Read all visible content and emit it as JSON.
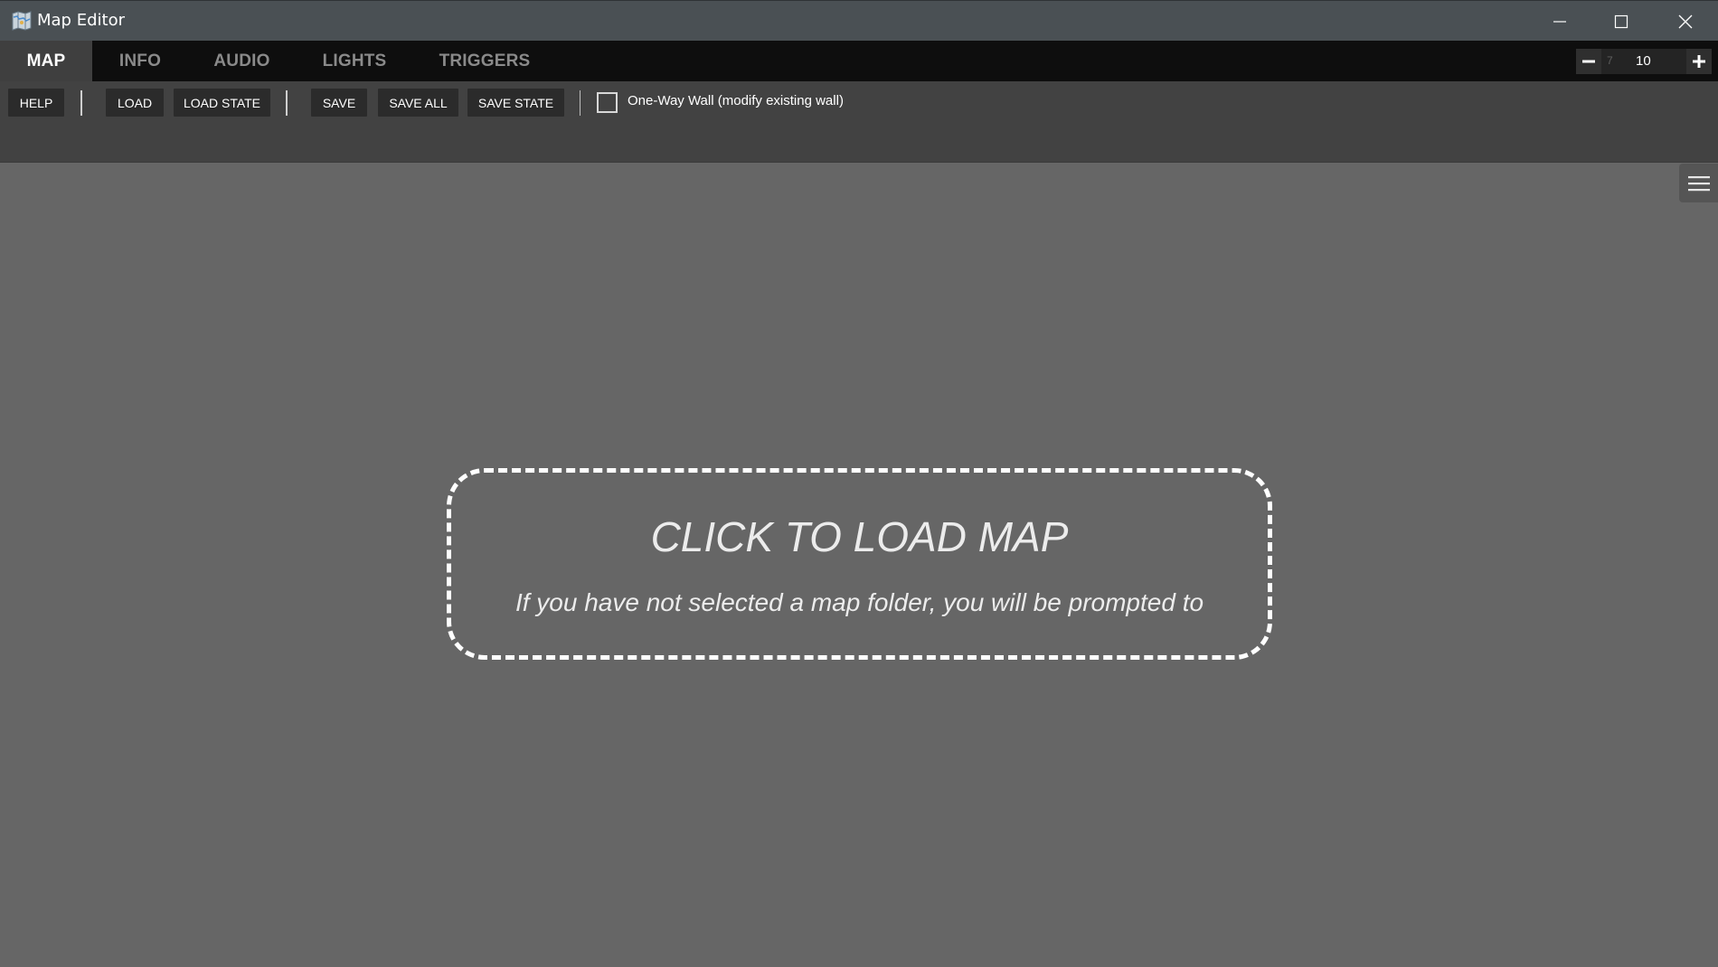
{
  "window": {
    "title": "Map Editor",
    "app_icon": "map-icon",
    "controls": [
      "minimize-icon",
      "maximize-icon",
      "close-icon"
    ]
  },
  "tabs": [
    {
      "label": "MAP",
      "active": true
    },
    {
      "label": "INFO",
      "active": false
    },
    {
      "label": "AUDIO",
      "active": false
    },
    {
      "label": "LIGHTS",
      "active": false
    },
    {
      "label": "TRIGGERS",
      "active": false
    }
  ],
  "zoom": {
    "secondary_value": "7",
    "value": "10"
  },
  "toolbar": {
    "help": "HELP",
    "load": "LOAD",
    "load_state": "LOAD STATE",
    "save": "SAVE",
    "save_all": "SAVE ALL",
    "save_state": "SAVE STATE",
    "one_way_wall_label": "One-Way Wall (modify existing wall)",
    "one_way_wall_checked": false
  },
  "side_menu": {
    "icon": "hamburger-menu-icon"
  },
  "dropzone": {
    "title": "CLICK TO LOAD MAP",
    "subtitle": "If you have not selected a map folder, you will be prompted to"
  },
  "colors": {
    "titlebar": "#4a5054",
    "tabbar": "#0e0e0e",
    "active_tab": "#3f3f3f",
    "toolbar": "#424242",
    "canvas": "#666666",
    "button": "#2b2b2b"
  }
}
